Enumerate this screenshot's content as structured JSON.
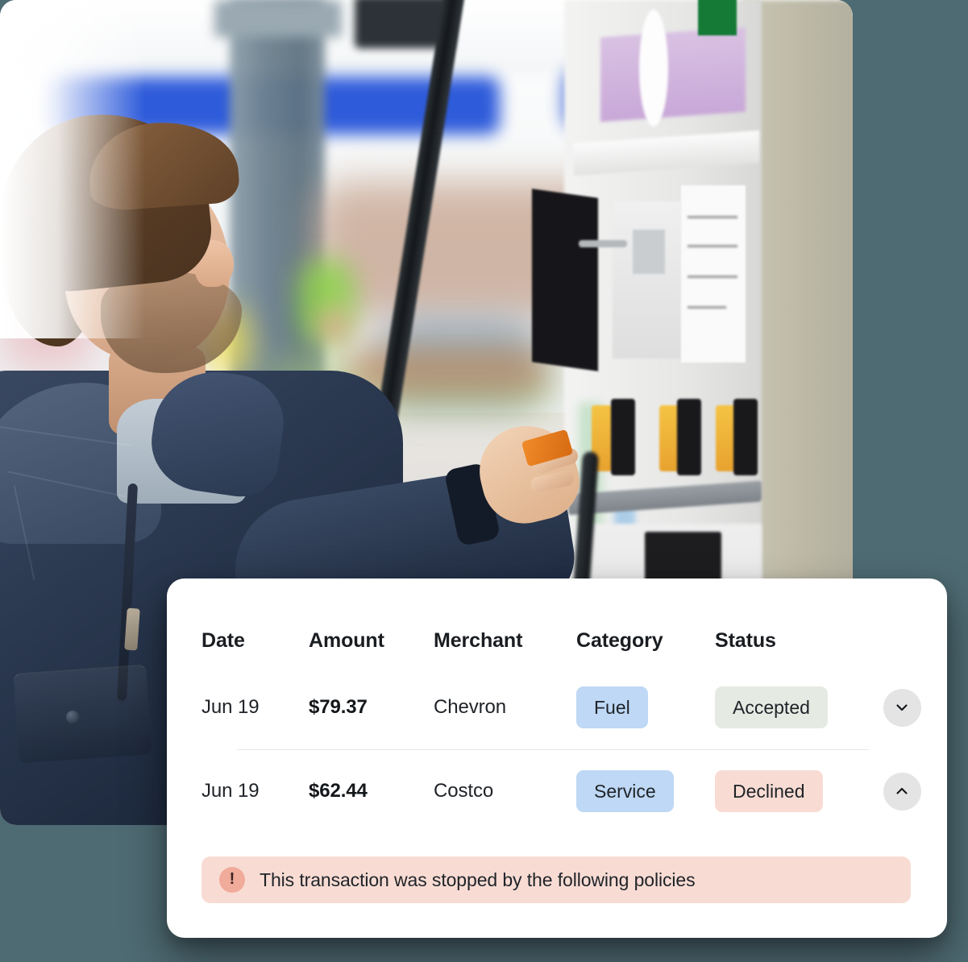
{
  "photo": {
    "alt_description": "Man in navy jacket using a credit card at a gas station fuel pump",
    "subject": "man-at-gas-pump"
  },
  "card": {
    "table": {
      "columns": [
        {
          "key": "date",
          "label": "Date"
        },
        {
          "key": "amount",
          "label": "Amount"
        },
        {
          "key": "merchant",
          "label": "Merchant"
        },
        {
          "key": "category",
          "label": "Category"
        },
        {
          "key": "status",
          "label": "Status"
        }
      ],
      "rows": [
        {
          "date": "Jun 19",
          "amount": "$79.37",
          "merchant": "Chevron",
          "category": "Fuel",
          "status": "Accepted",
          "expand_icon": "chevron-down-icon"
        },
        {
          "date": "Jun 19",
          "amount": "$62.44",
          "merchant": "Costco",
          "category": "Service",
          "status": "Declined",
          "expand_icon": "chevron-up-icon"
        }
      ]
    },
    "alert": {
      "icon": "exclamation-circle-icon",
      "icon_glyph": "!",
      "message": "This transaction was stopped by the following policies"
    }
  },
  "colors": {
    "page_background": "#4e6a72",
    "card_background": "#ffffff",
    "category_badge": "#bed8f5",
    "status_accepted": "#e5eae3",
    "status_declined": "#f8dcd4",
    "alert_background": "#f8dcd4",
    "alert_icon": "#f1ab9a",
    "chevron_button": "#e4e4e4",
    "text_primary": "#1f2328",
    "divider": "#e7e8ea"
  }
}
